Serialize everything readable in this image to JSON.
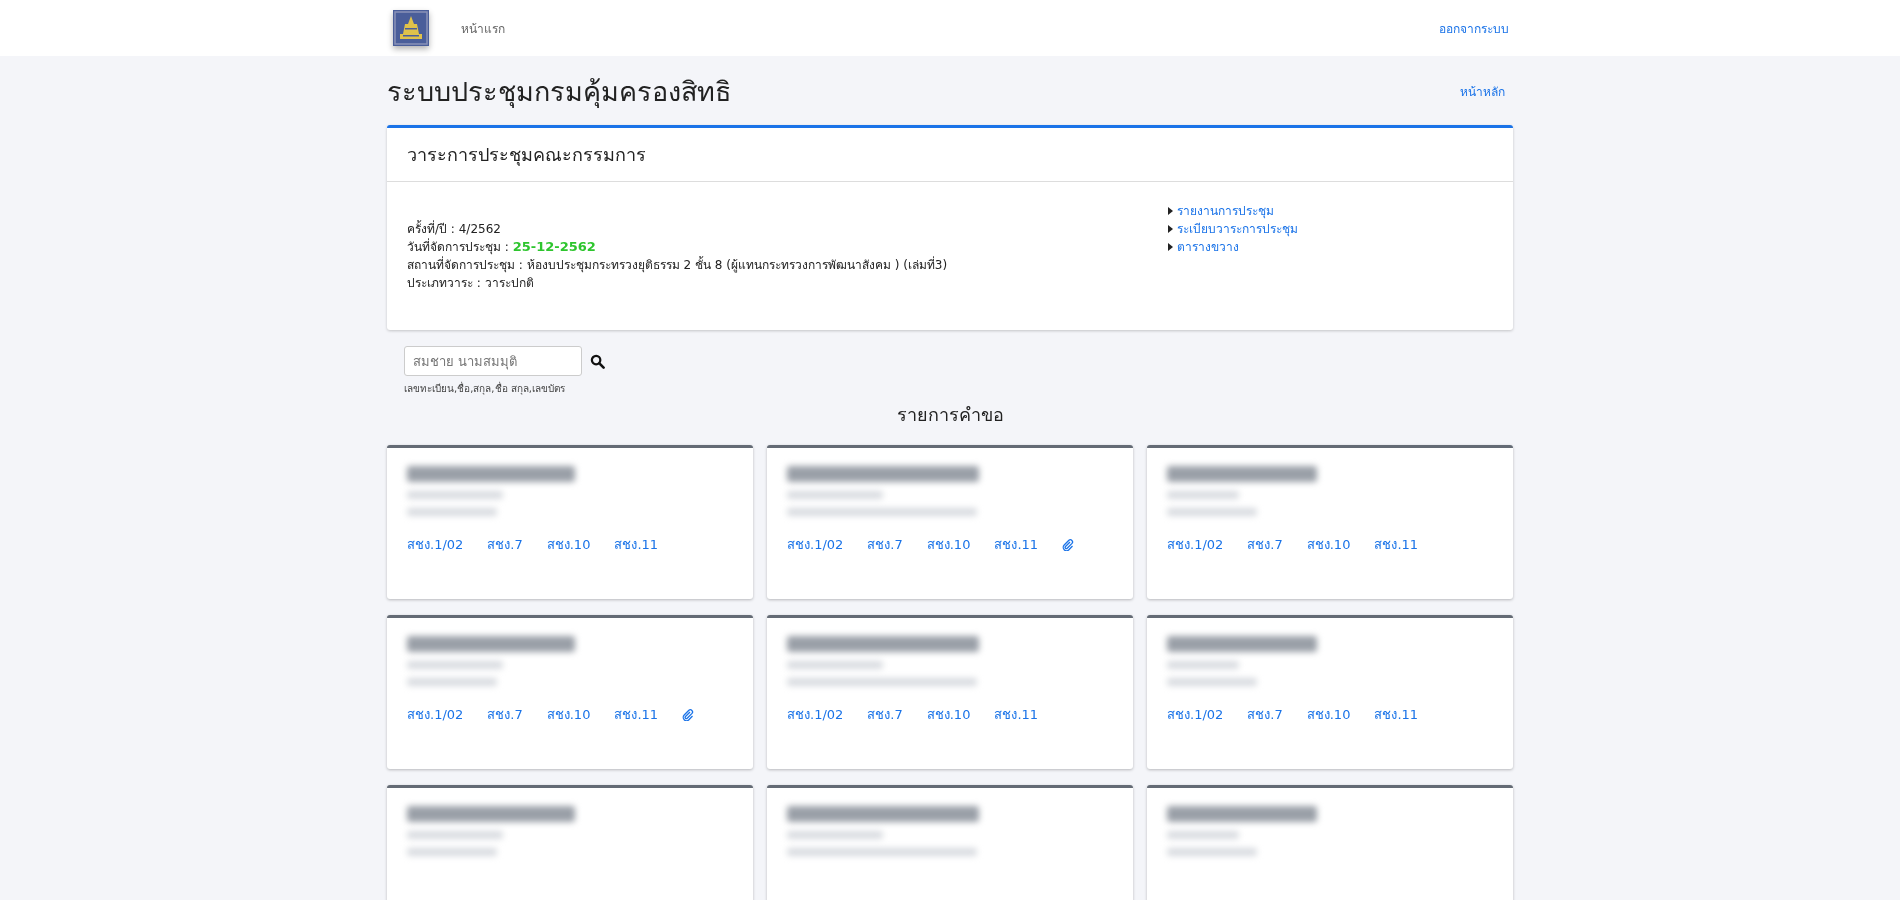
{
  "navbar": {
    "home_link": "หน้าแรก",
    "logout_link": "ออกจากระบบ"
  },
  "page": {
    "title": "ระบบประชุมกรมคุ้มครองสิทธิ",
    "main_link": "หน้าหลัก"
  },
  "agenda": {
    "title": "วาระการประชุมคณะกรรมการ",
    "fields": [
      {
        "label": "ครั้งที่/ปี : ",
        "value": "4/2562",
        "highlight": false
      },
      {
        "label": "วันที่จัดการประชุม : ",
        "value": "25-12-2562",
        "highlight": true
      },
      {
        "label": "สถานที่จัดการประชุม : ",
        "value": "ห้องบประชุมกระทรวงยุติธรรม 2 ชั้น 8 (ผู้แทนกระทรวงการพัฒนาสังคม ) (เล่มที่3)",
        "highlight": false
      },
      {
        "label": "ประเภทวาระ : ",
        "value": "วาระปกติ",
        "highlight": false
      }
    ],
    "links": [
      "รายงานการประชุม",
      "ระเบียบวาระการประชุม",
      "ตารางขวาง"
    ]
  },
  "search": {
    "placeholder": "สมชาย นามสมมุติ",
    "hint": "เลขทะเบียน,ชื่อ,สกุล,ชื่อ สกุล,เลขบัตร"
  },
  "requests": {
    "title": "รายการคำขอ",
    "cards": [
      {
        "links": [
          "สชง.1/02",
          "สชง.7",
          "สชง.10",
          "สชง.11"
        ],
        "attachment": false
      },
      {
        "links": [
          "สชง.1/02",
          "สชง.7",
          "สชง.10",
          "สชง.11"
        ],
        "attachment": true
      },
      {
        "links": [
          "สชง.1/02",
          "สชง.7",
          "สชง.10",
          "สชง.11"
        ],
        "attachment": false
      },
      {
        "links": [
          "สชง.1/02",
          "สชง.7",
          "สชง.10",
          "สชง.11"
        ],
        "attachment": true
      },
      {
        "links": [
          "สชง.1/02",
          "สชง.7",
          "สชง.10",
          "สชง.11"
        ],
        "attachment": false
      },
      {
        "links": [
          "สชง.1/02",
          "สชง.7",
          "สชง.10",
          "สชง.11"
        ],
        "attachment": false
      }
    ]
  }
}
